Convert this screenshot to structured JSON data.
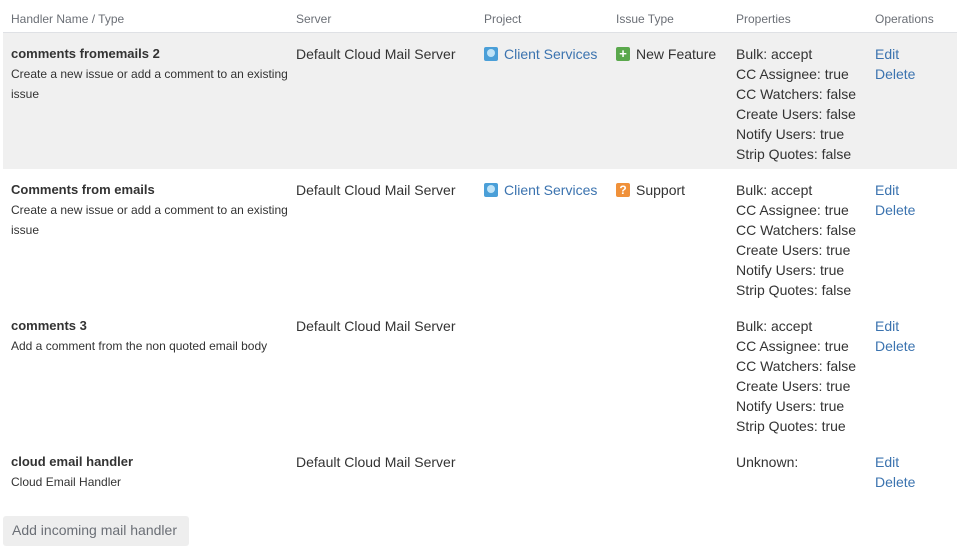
{
  "headers": {
    "name": "Handler Name / Type",
    "server": "Server",
    "project": "Project",
    "issue_type": "Issue Type",
    "properties": "Properties",
    "operations": "Operations"
  },
  "rows": [
    {
      "name": "comments fromemails 2",
      "description": "Create a new issue or add a comment to an existing issue",
      "server": "Default Cloud Mail Server",
      "project": "Client Services",
      "project_icon": "project-avatar-icon",
      "issue_type": "New Feature",
      "issue_type_icon": "new-feature-icon",
      "properties": [
        "Bulk: accept",
        "CC Assignee: true",
        "CC Watchers: false",
        "Create Users: false",
        "Notify Users: true",
        "Strip Quotes: false"
      ],
      "edit": "Edit",
      "delete": "Delete"
    },
    {
      "name": "Comments from emails",
      "description": "Create a new issue or add a comment to an existing issue",
      "server": "Default Cloud Mail Server",
      "project": "Client Services",
      "project_icon": "project-avatar-icon",
      "issue_type": "Support",
      "issue_type_icon": "support-icon",
      "properties": [
        "Bulk: accept",
        "CC Assignee: true",
        "CC Watchers: false",
        "Create Users: true",
        "Notify Users: true",
        "Strip Quotes: false"
      ],
      "edit": "Edit",
      "delete": "Delete"
    },
    {
      "name": "comments 3",
      "description": "Add a comment from the non quoted email body",
      "server": "Default Cloud Mail Server",
      "project": "",
      "issue_type": "",
      "properties": [
        "Bulk: accept",
        "CC Assignee: true",
        "CC Watchers: false",
        "Create Users: true",
        "Notify Users: true",
        "Strip Quotes: true"
      ],
      "edit": "Edit",
      "delete": "Delete"
    },
    {
      "name": "cloud email handler",
      "description": "Cloud Email Handler",
      "server": "Default Cloud Mail Server",
      "project": "",
      "issue_type": "",
      "properties": [
        "Unknown:"
      ],
      "edit": "Edit",
      "delete": "Delete"
    }
  ],
  "add_button": "Add incoming mail handler",
  "colors": {
    "link": "#3b73af",
    "highlight_row": "#f0f0f0",
    "new_feature": "#5aa84c",
    "support": "#f0913a",
    "project_avatar": "#4a9fd8"
  }
}
